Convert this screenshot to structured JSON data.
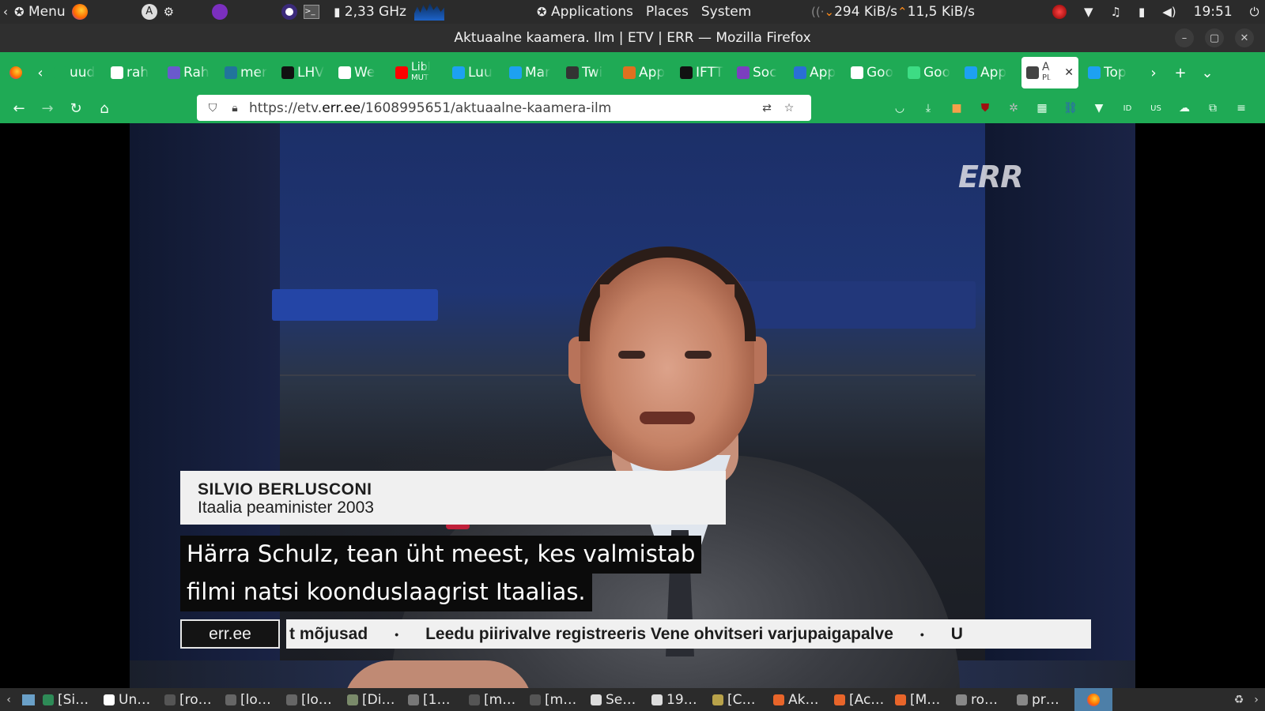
{
  "system_panel": {
    "menu_label": "Menu",
    "cpu_freq": "2,33 GHz",
    "applications": "Applications",
    "places": "Places",
    "system": "System",
    "net_down": "294 KiB/s",
    "net_up": "11,5 KiB/s",
    "clock": "19:51"
  },
  "window": {
    "title": "Aktuaalne kaamera. Ilm | ETV | ERR — Mozilla Firefox"
  },
  "tabs": [
    {
      "label": "uud",
      "fav_color": "#1faa55",
      "icon": "news-icon"
    },
    {
      "label": "rah",
      "fav_color": "#ffffff",
      "icon": "google-icon"
    },
    {
      "label": "Rah",
      "fav_color": "#6a5acd",
      "icon": "bank-icon"
    },
    {
      "label": "mer",
      "fav_color": "#21759b",
      "icon": "wordpress-icon"
    },
    {
      "label": "LHV",
      "fav_color": "#111111",
      "icon": "lhv-icon"
    },
    {
      "label": "We",
      "fav_color": "#ffffff",
      "icon": "google-icon"
    },
    {
      "label": "Libl",
      "sub": "MUT",
      "fav_color": "#ff0000",
      "icon": "youtube-icon"
    },
    {
      "label": "Luu",
      "fav_color": "#1da1f2",
      "icon": "twitter-icon"
    },
    {
      "label": "Mar",
      "fav_color": "#1da1f2",
      "icon": "twitter-icon"
    },
    {
      "label": "Twi",
      "fav_color": "#333333",
      "icon": "tech-icon"
    },
    {
      "label": "App",
      "fav_color": "#e07020",
      "icon": "nbc-icon"
    },
    {
      "label": "IFTT",
      "fav_color": "#111111",
      "icon": "ifttt-icon"
    },
    {
      "label": "Soc",
      "fav_color": "#7b3fbf",
      "icon": "social-icon"
    },
    {
      "label": "App",
      "fav_color": "#2a6fd6",
      "icon": "code-icon"
    },
    {
      "label": "Goo",
      "fav_color": "#ffffff",
      "icon": "google-icon"
    },
    {
      "label": "Goo",
      "fav_color": "#3ddc84",
      "icon": "android-icon"
    },
    {
      "label": "App",
      "fav_color": "#1da1f2",
      "icon": "twitter-icon"
    },
    {
      "label": "A",
      "sub": "PL",
      "active": true,
      "fav_color": "#444444",
      "icon": "speaker-icon"
    },
    {
      "label": "Top",
      "fav_color": "#1da1f2",
      "icon": "twitter-icon"
    }
  ],
  "address_bar": {
    "url_prefix": "https://etv.",
    "url_domain": "err.ee",
    "url_path": "/1608995651/aktuaalne-kaamera-ilm"
  },
  "video": {
    "logo": "ERR",
    "name": "SILVIO BERLUSCONI",
    "role": "Itaalia peaminister 2003",
    "subtitle_line1": "Härra Schulz, tean üht meest, kes valmistab",
    "subtitle_line2": "filmi natsi koonduslaagrist Itaalias.",
    "ticker_source": "err.ee",
    "ticker_items": [
      "t mõjusad",
      "Leedu piirivalve registreeris Vene ohvitseri varjupaigapalve",
      "U"
    ],
    "ticker_separator": "•"
  },
  "taskbar": [
    {
      "label": "[Si…",
      "color": "#2e8b57"
    },
    {
      "label": "Un…",
      "color": "#ffffff"
    },
    {
      "label": "[ro…",
      "color": "#555555"
    },
    {
      "label": "[lo…",
      "color": "#666666"
    },
    {
      "label": "[lo…",
      "color": "#666666"
    },
    {
      "label": "[Di…",
      "color": "#7a8a6a"
    },
    {
      "label": "[1…",
      "color": "#777777"
    },
    {
      "label": "[m…",
      "color": "#555555"
    },
    {
      "label": "[m…",
      "color": "#555555"
    },
    {
      "label": "Se…",
      "color": "#dddddd"
    },
    {
      "label": "19…",
      "color": "#dddddd"
    },
    {
      "label": "[C…",
      "color": "#b8a24a"
    },
    {
      "label": "Ak…",
      "color": "#e8652a"
    },
    {
      "label": "[Ac…",
      "color": "#e8652a"
    },
    {
      "label": "[M…",
      "color": "#e8652a"
    },
    {
      "label": "ro…",
      "color": "#888888"
    },
    {
      "label": "pr…",
      "color": "#888888"
    }
  ],
  "colors": {
    "toolbar": "#1faa55",
    "panel": "#2b2b2b",
    "active_task": "#4d7fa8"
  }
}
